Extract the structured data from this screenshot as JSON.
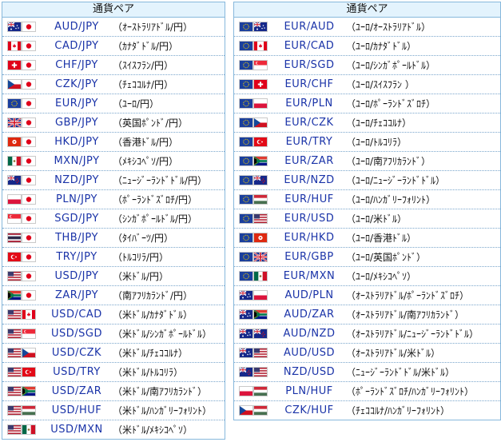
{
  "left_table": {
    "header": "通貨ペア",
    "rows": [
      {
        "flags": [
          "au",
          "jp"
        ],
        "pair": "AUD/JPY",
        "desc": "（ｵｰｽﾄﾗﾘｱﾄﾞﾙ/円）"
      },
      {
        "flags": [
          "ca",
          "jp"
        ],
        "pair": "CAD/JPY",
        "desc": "（ｶﾅﾀﾞﾄﾞﾙ/円）"
      },
      {
        "flags": [
          "ch",
          "jp"
        ],
        "pair": "CHF/JPY",
        "desc": "（ｽｲｽﾌﾗﾝ/円）"
      },
      {
        "flags": [
          "cz",
          "jp"
        ],
        "pair": "CZK/JPY",
        "desc": "（ﾁｪｺｺﾙﾅ/円）"
      },
      {
        "flags": [
          "eu",
          "jp"
        ],
        "pair": "EUR/JPY",
        "desc": "（ﾕｰﾛ/円）"
      },
      {
        "flags": [
          "gb",
          "jp"
        ],
        "pair": "GBP/JPY",
        "desc": "（英国ﾎﾟﾝﾄﾞ/円）"
      },
      {
        "flags": [
          "hk",
          "jp"
        ],
        "pair": "HKD/JPY",
        "desc": "（香港ﾄﾞﾙ/円）"
      },
      {
        "flags": [
          "mx",
          "jp"
        ],
        "pair": "MXN/JPY",
        "desc": "（ﾒｷｼｺﾍﾟｿ/円）"
      },
      {
        "flags": [
          "nz",
          "jp"
        ],
        "pair": "NZD/JPY",
        "desc": "（ﾆｭｰｼﾞｰﾗﾝﾄﾞﾄﾞﾙ/円）"
      },
      {
        "flags": [
          "pl",
          "jp"
        ],
        "pair": "PLN/JPY",
        "desc": "（ﾎﾟｰﾗﾝﾄﾞｽﾞﾛﾁ/円）"
      },
      {
        "flags": [
          "sg",
          "jp"
        ],
        "pair": "SGD/JPY",
        "desc": "（ｼﾝｶﾞﾎﾟｰﾙﾄﾞﾙ/円）"
      },
      {
        "flags": [
          "th",
          "jp"
        ],
        "pair": "THB/JPY",
        "desc": "（ﾀｲﾊﾞｰﾂ/円）"
      },
      {
        "flags": [
          "tr",
          "jp"
        ],
        "pair": "TRY/JPY",
        "desc": "（ﾄﾙｺﾘﾗ/円）"
      },
      {
        "flags": [
          "us",
          "jp"
        ],
        "pair": "USD/JPY",
        "desc": "（米ﾄﾞﾙ/円）"
      },
      {
        "flags": [
          "za",
          "jp"
        ],
        "pair": "ZAR/JPY",
        "desc": "（南ｱﾌﾘｶﾗﾝﾄﾞ/円）"
      },
      {
        "flags": [
          "us",
          "ca"
        ],
        "pair": "USD/CAD",
        "desc": "（米ﾄﾞﾙ/ｶﾅﾀﾞﾄﾞﾙ）"
      },
      {
        "flags": [
          "us",
          "sg"
        ],
        "pair": "USD/SGD",
        "desc": "（米ﾄﾞﾙ/ｼﾝｶﾞﾎﾟｰﾙﾄﾞﾙ）"
      },
      {
        "flags": [
          "us",
          "cz"
        ],
        "pair": "USD/CZK",
        "desc": "（米ﾄﾞﾙ/ﾁｪｺｺﾙﾅ）"
      },
      {
        "flags": [
          "us",
          "tr"
        ],
        "pair": "USD/TRY",
        "desc": "（米ﾄﾞﾙ/ﾄﾙｺﾘﾗ）"
      },
      {
        "flags": [
          "us",
          "za"
        ],
        "pair": "USD/ZAR",
        "desc": "（米ﾄﾞﾙ/南ｱﾌﾘｶﾗﾝﾄﾞ）"
      },
      {
        "flags": [
          "us",
          "hu"
        ],
        "pair": "USD/HUF",
        "desc": "（米ﾄﾞﾙ/ﾊﾝｶﾞﾘｰﾌｫﾘﾝﾄ）"
      },
      {
        "flags": [
          "us",
          "mx"
        ],
        "pair": "USD/MXN",
        "desc": "（米ﾄﾞﾙ/ﾒｷｼｺﾍﾟｿ）"
      }
    ]
  },
  "right_table": {
    "header": "通貨ペア",
    "rows": [
      {
        "flags": [
          "eu",
          "au"
        ],
        "pair": "EUR/AUD",
        "desc": "（ﾕｰﾛ/ｵｰｽﾄﾗﾘｱﾄﾞﾙ）"
      },
      {
        "flags": [
          "eu",
          "ca"
        ],
        "pair": "EUR/CAD",
        "desc": "（ﾕｰﾛ/ｶﾅﾀﾞﾄﾞﾙ）"
      },
      {
        "flags": [
          "eu",
          "sg"
        ],
        "pair": "EUR/SGD",
        "desc": "（ﾕｰﾛ/ｼﾝｶﾞﾎﾟｰﾙﾄﾞﾙ）"
      },
      {
        "flags": [
          "eu",
          "ch"
        ],
        "pair": "EUR/CHF",
        "desc": "（ﾕｰﾛ/ｽｲｽﾌﾗﾝ ）"
      },
      {
        "flags": [
          "eu",
          "pl"
        ],
        "pair": "EUR/PLN",
        "desc": "（ﾕｰﾛ/ﾎﾟｰﾗﾝﾄﾞｽﾞﾛﾁ）"
      },
      {
        "flags": [
          "eu",
          "cz"
        ],
        "pair": "EUR/CZK",
        "desc": "（ﾕｰﾛ/ﾁｪｺｺﾙﾅ）"
      },
      {
        "flags": [
          "eu",
          "tr"
        ],
        "pair": "EUR/TRY",
        "desc": "（ﾕｰﾛ/ﾄﾙｺﾘﾗ）"
      },
      {
        "flags": [
          "eu",
          "za"
        ],
        "pair": "EUR/ZAR",
        "desc": "（ﾕｰﾛ/南ｱﾌﾘｶﾗﾝﾄﾞ）"
      },
      {
        "flags": [
          "eu",
          "nz"
        ],
        "pair": "EUR/NZD",
        "desc": "（ﾕｰﾛ/ﾆｭｰｼﾞｰﾗﾝﾄﾞﾄﾞﾙ）"
      },
      {
        "flags": [
          "eu",
          "hu"
        ],
        "pair": "EUR/HUF",
        "desc": "（ﾕｰﾛ/ﾊﾝｶﾞﾘｰﾌｫﾘﾝﾄ）"
      },
      {
        "flags": [
          "eu",
          "us"
        ],
        "pair": "EUR/USD",
        "desc": "（ﾕｰﾛ/米ﾄﾞﾙ）"
      },
      {
        "flags": [
          "eu",
          "hk"
        ],
        "pair": "EUR/HKD",
        "desc": "（ﾕｰﾛ/香港ﾄﾞﾙ）"
      },
      {
        "flags": [
          "eu",
          "gb"
        ],
        "pair": "EUR/GBP",
        "desc": "（ﾕｰﾛ/英国ﾎﾟﾝﾄﾞ）"
      },
      {
        "flags": [
          "eu",
          "mx"
        ],
        "pair": "EUR/MXN",
        "desc": "（ﾕｰﾛ/ﾒｷｼｺﾍﾟｿ）"
      },
      {
        "flags": [
          "au",
          "pl"
        ],
        "pair": "AUD/PLN",
        "desc": "（ｵｰｽﾄﾗﾘｱﾄﾞﾙ/ﾎﾟｰﾗﾝﾄﾞｽﾞﾛﾁ）"
      },
      {
        "flags": [
          "au",
          "za"
        ],
        "pair": "AUD/ZAR",
        "desc": "（ｵｰｽﾄﾗﾘｱﾄﾞﾙ/南ｱﾌﾘｶﾗﾝﾄﾞ）"
      },
      {
        "flags": [
          "au",
          "nz"
        ],
        "pair": "AUD/NZD",
        "desc": "（ｵｰｽﾄﾗﾘｱﾄﾞﾙ/ﾆｭｰｼﾞｰﾗﾝﾄﾞﾄﾞﾙ）"
      },
      {
        "flags": [
          "au",
          "us"
        ],
        "pair": "AUD/USD",
        "desc": "（ｵｰｽﾄﾗﾘｱﾄﾞﾙ/米ﾄﾞﾙ）"
      },
      {
        "flags": [
          "nz",
          "us"
        ],
        "pair": "NZD/USD",
        "desc": "（ﾆｭｰｼﾞｰﾗﾝﾄﾞﾄﾞﾙ/米ﾄﾞﾙ）"
      },
      {
        "flags": [
          "pl",
          "hu"
        ],
        "pair": "PLN/HUF",
        "desc": "（ﾎﾟｰﾗﾝﾄﾞｽﾞﾛﾁ/ﾊﾝｶﾞﾘｰﾌｫﾘﾝﾄ）"
      },
      {
        "flags": [
          "cz",
          "hu"
        ],
        "pair": "CZK/HUF",
        "desc": "（ﾁｪｺｺﾙﾅ/ﾊﾝｶﾞﾘｰﾌｫﾘﾝﾄ）"
      }
    ]
  }
}
